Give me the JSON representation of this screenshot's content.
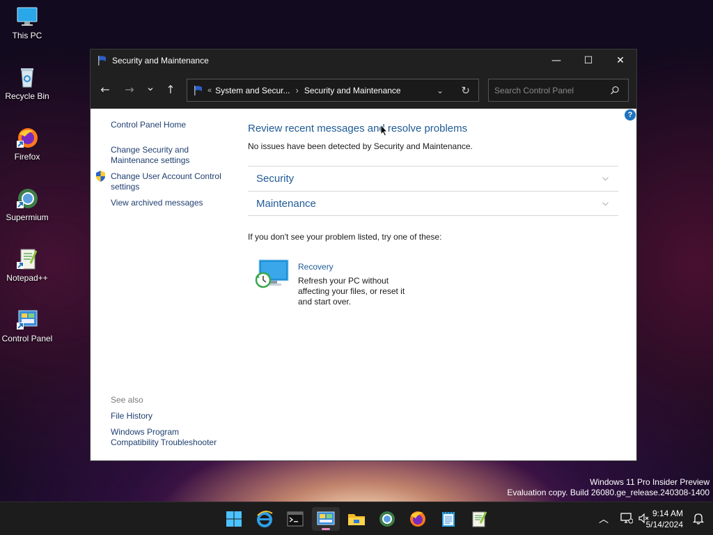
{
  "desktop": {
    "icons": [
      {
        "label": "This PC"
      },
      {
        "label": "Recycle Bin"
      },
      {
        "label": "Firefox"
      },
      {
        "label": "Supermium"
      },
      {
        "label": "Notepad++"
      },
      {
        "label": "Control Panel"
      }
    ]
  },
  "window": {
    "title": "Security and Maintenance",
    "controls": {
      "minimize": "—",
      "maximize": "☐",
      "close": "✕"
    }
  },
  "nav": {
    "back": "←",
    "forward": "→",
    "recent": "⌄",
    "up": "↑",
    "breadcrumb_overflow": "«",
    "breadcrumb": [
      "System and Secur...",
      "Security and Maintenance"
    ],
    "breadcrumb_sep": "›",
    "search_placeholder": "Search Control Panel"
  },
  "left_pane": {
    "home": "Control Panel Home",
    "links": [
      "Change Security and Maintenance settings",
      "Change User Account Control settings",
      "View archived messages"
    ],
    "see_also_label": "See also",
    "see_also": [
      "File History",
      "Windows Program Compatibility Troubleshooter"
    ]
  },
  "main": {
    "heading": "Review recent messages and resolve problems",
    "status": "No issues have been detected by Security and Maintenance.",
    "sections": [
      "Security",
      "Maintenance"
    ],
    "try_text": "If you don't see your problem listed, try one of these:",
    "recovery": {
      "title": "Recovery",
      "description": "Refresh your PC without affecting your files, or reset it and start over."
    }
  },
  "watermark": {
    "line1": "Windows 11 Pro Insider Preview",
    "line2": "Evaluation copy. Build 26080.ge_release.240308-1400"
  },
  "taskbar": {
    "apps": [
      "start-icon",
      "internet-explorer-icon",
      "terminal-icon",
      "control-panel-icon",
      "file-explorer-icon",
      "supermium-icon",
      "firefox-icon",
      "notepad-icon",
      "notepadpp-icon"
    ],
    "active_app": "control-panel-icon"
  },
  "clock": {
    "time": "9:14 AM",
    "date": "5/14/2024"
  },
  "colors": {
    "link": "#1e5a96",
    "titlebar": "#202020",
    "accent": "#1e73be"
  }
}
